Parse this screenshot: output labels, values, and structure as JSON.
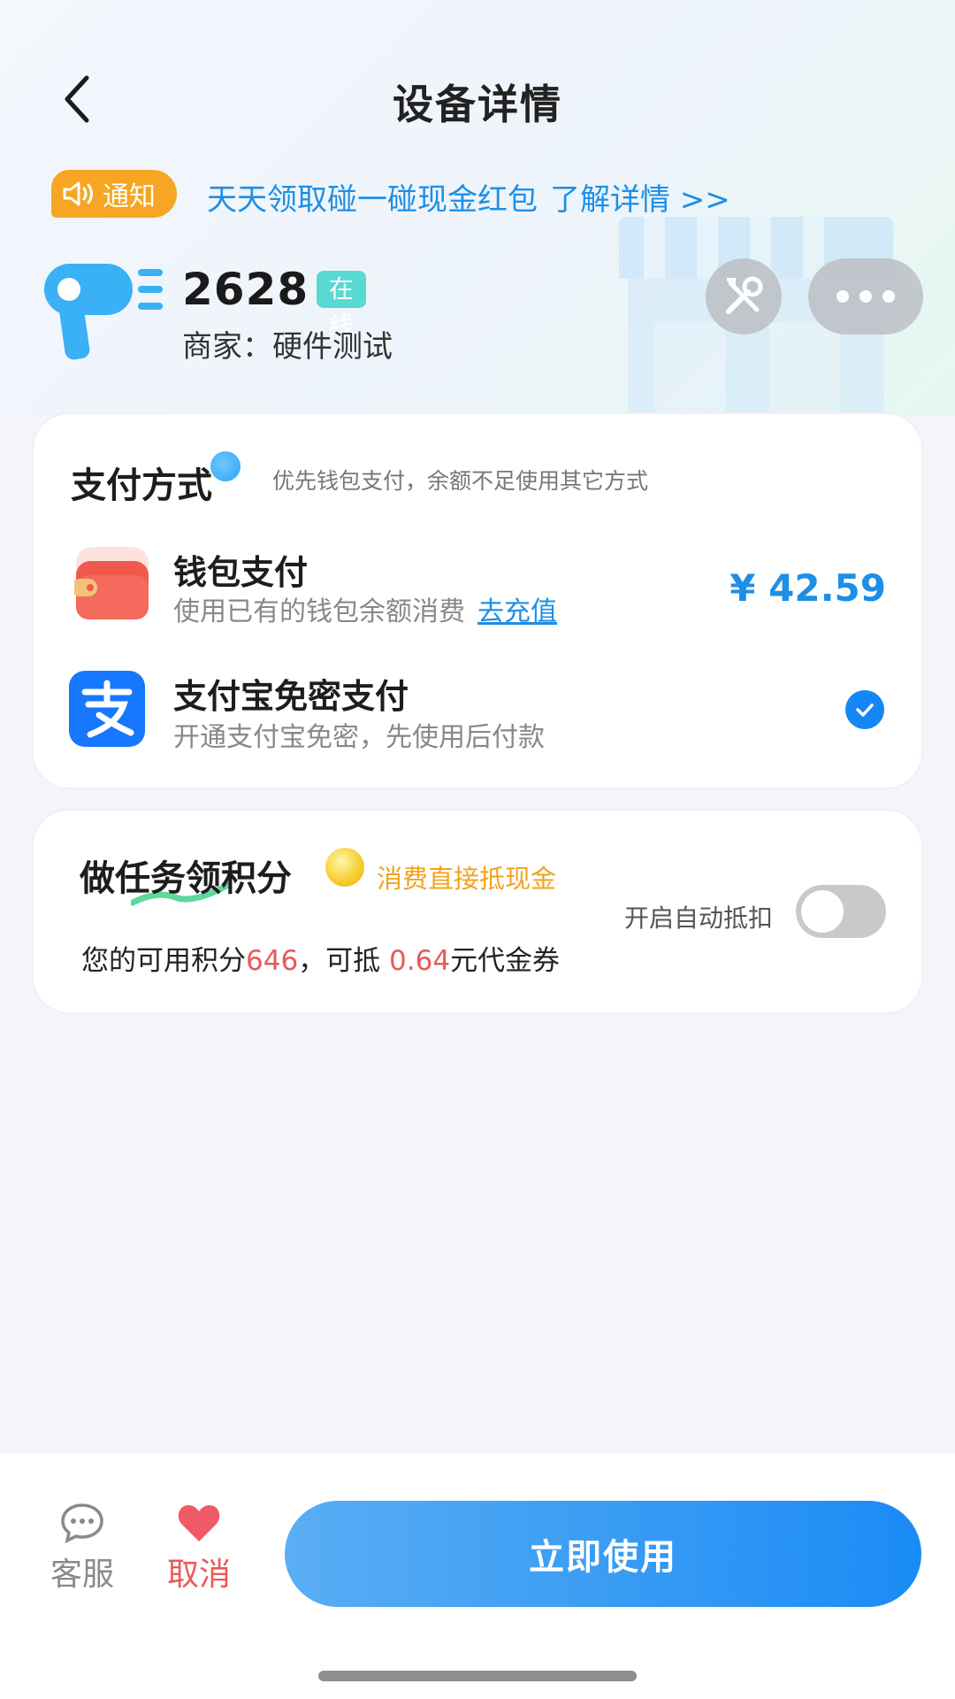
{
  "header": {
    "title": "设备详情"
  },
  "notice": {
    "badge": "通知",
    "text": "天天领取碰一碰现金红包",
    "link": "了解详情 >>"
  },
  "device": {
    "id": "2628",
    "status": "在线",
    "merchant": "商家：硬件测试"
  },
  "payment": {
    "title": "支付方式",
    "hint": "优先钱包支付，余额不足使用其它方式",
    "wallet": {
      "title": "钱包支付",
      "subtitle": "使用已有的钱包余额消费",
      "link": "去充值",
      "balance": "¥ 42.59"
    },
    "alipay": {
      "title": "支付宝免密支付",
      "subtitle": "开通支付宝免密，先使用后付款",
      "selected": true
    }
  },
  "points": {
    "title": "做任务领积分",
    "tag": "消费直接抵现金",
    "auto_label": "开启自动抵扣",
    "auto_enabled": false,
    "text_prefix": "您的可用积分",
    "points_value": "646",
    "text_mid": "，可抵 ",
    "amount": "0.64",
    "text_suffix": "元代金券"
  },
  "bottom": {
    "service_label": "客服",
    "cancel_label": "取消",
    "use_label": "立即使用"
  },
  "colors": {
    "accent": "#1586f5",
    "notice": "#f6a623",
    "online": "#58d9d2",
    "highlight_red": "#e85a5a"
  }
}
